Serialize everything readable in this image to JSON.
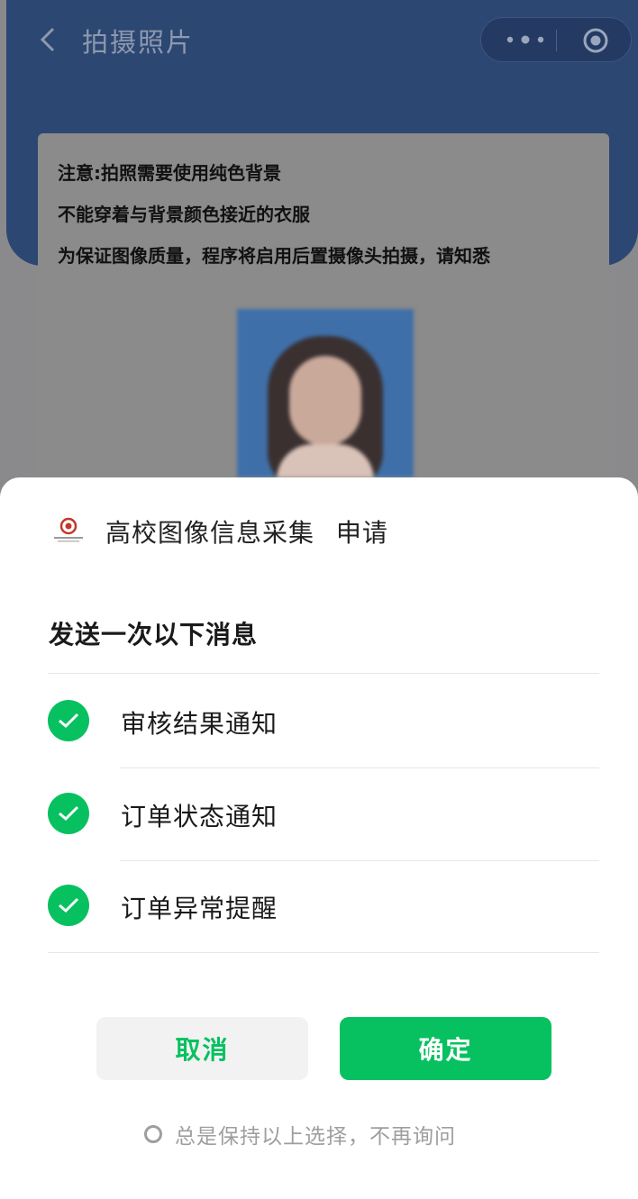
{
  "nav": {
    "title": "拍摄照片",
    "back_icon": "chevron-left-icon",
    "more_icon": "more-dots-icon",
    "close_icon": "target-circle-icon"
  },
  "notice": {
    "line1": "注意:拍照需要使用纯色背景",
    "line2": "不能穿着与背景颜色接近的衣服",
    "line3": "为保证图像质量，程序将启用后置摄像头拍摄，请知悉"
  },
  "sample_photo": {
    "background_color": "#3f6fa8"
  },
  "sheet": {
    "app_name": "高校图像信息采集",
    "request_word": "申请",
    "section_title": "发送一次以下消息",
    "items": [
      {
        "label": "审核结果通知",
        "checked": true
      },
      {
        "label": "订单状态通知",
        "checked": true
      },
      {
        "label": "订单异常提醒",
        "checked": true
      }
    ],
    "cancel_label": "取消",
    "confirm_label": "确定",
    "remember_label": "总是保持以上选择，不再询问",
    "remember_checked": false
  },
  "colors": {
    "accent": "#07c160",
    "header": "#2d4773"
  }
}
